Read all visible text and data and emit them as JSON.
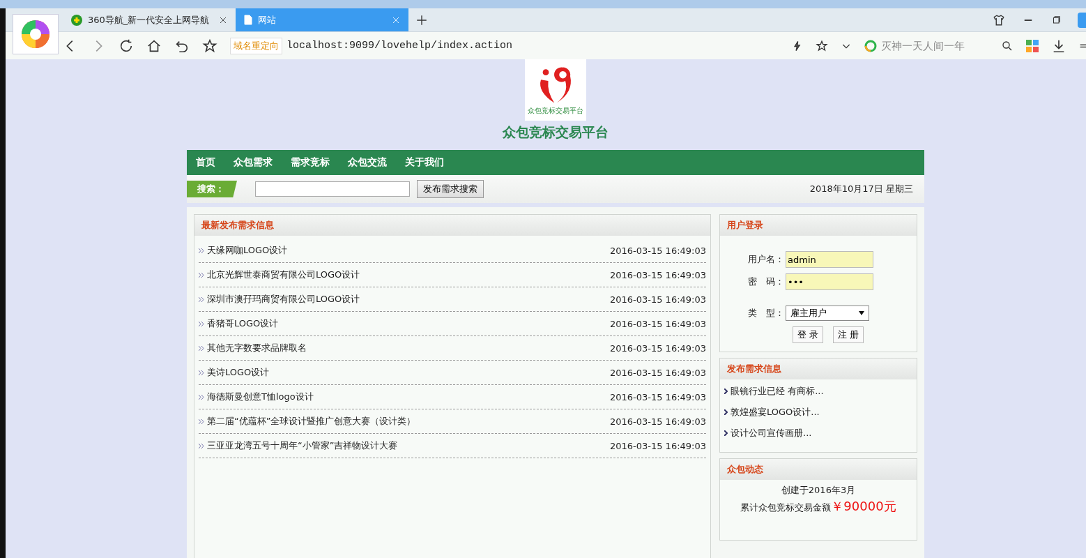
{
  "browser": {
    "tabs": [
      {
        "label": "360导航_新一代安全上网导航",
        "selected": false,
        "kind": "nav"
      },
      {
        "label": "网站",
        "selected": true,
        "kind": "page"
      }
    ],
    "redirect_badge": "域名重定向",
    "url": "localhost:9099/lovehelp/index.action",
    "search_placeholder": "灭神一天人间一年"
  },
  "site": {
    "logo_caption": "众包竞标交易平台",
    "title": "众包竞标交易平台"
  },
  "nav": [
    "首页",
    "众包需求",
    "需求竞标",
    "众包交流",
    "关于我们"
  ],
  "search": {
    "label": "搜索：",
    "button": "发布需求搜索",
    "date": "2018年10月17日 星期三"
  },
  "latest": {
    "title": "最新发布需求信息",
    "rows": [
      {
        "name": "天缘网咖LOGO设计",
        "time": "2016-03-15 16:49:03"
      },
      {
        "name": "北京光辉世泰商贸有限公司LOGO设计",
        "time": "2016-03-15 16:49:03"
      },
      {
        "name": "深圳市澳孖玛商贸有限公司LOGO设计",
        "time": "2016-03-15 16:49:03"
      },
      {
        "name": "香猪哥LOGO设计",
        "time": "2016-03-15 16:49:03"
      },
      {
        "name": "其他无字数要求品牌取名",
        "time": "2016-03-15 16:49:03"
      },
      {
        "name": "美诗LOGO设计",
        "time": "2016-03-15 16:49:03"
      },
      {
        "name": "海德斯曼创意T恤logo设计",
        "time": "2016-03-15 16:49:03"
      },
      {
        "name": "第二届“优蕴杯”全球设计暨推广创意大赛（设计类）",
        "time": "2016-03-15 16:49:03"
      },
      {
        "name": "三亚亚龙湾五号十周年“小管家”吉祥物设计大赛",
        "time": "2016-03-15 16:49:03"
      }
    ]
  },
  "login": {
    "title": "用户登录",
    "username_label": "用户名：",
    "username": "admin",
    "password_label": "密　码：",
    "password": "•••",
    "type_label": "类　型：",
    "type": "雇主用户",
    "buttons": [
      "登 录",
      "注 册"
    ]
  },
  "posts": {
    "title": "发布需求信息",
    "items": [
      "眼镜行业已经 有商标...",
      "敦煌盛宴LOGO设计...",
      "设计公司宣传画册..."
    ]
  },
  "news": {
    "title": "众包动态",
    "line1": "创建于2016年3月",
    "line2": "累计众包竞标交易金额",
    "amount": "￥90000元"
  }
}
